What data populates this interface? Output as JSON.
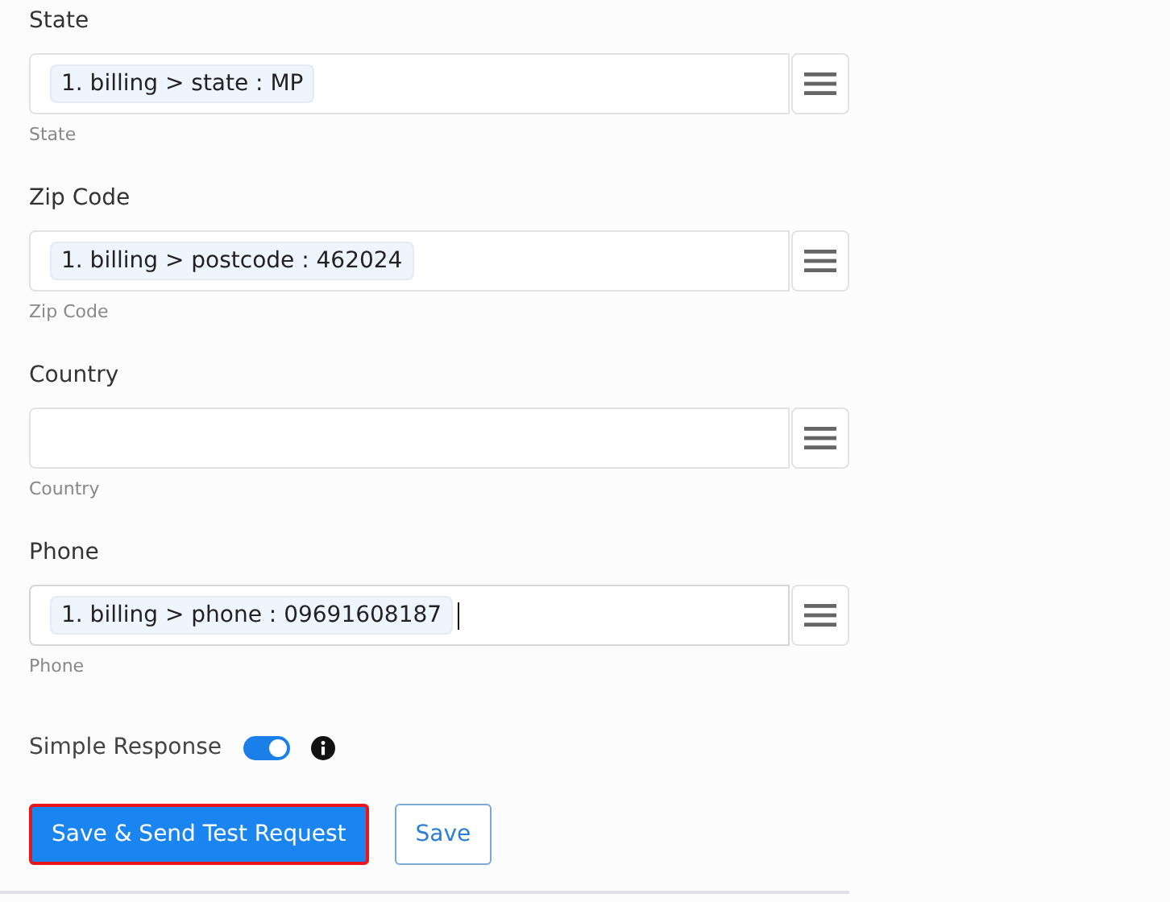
{
  "fields": [
    {
      "label": "State",
      "token": "1. billing > state : MP",
      "hint": "State",
      "focused": false
    },
    {
      "label": "Zip Code",
      "token": "1. billing > postcode : 462024",
      "hint": "Zip Code",
      "focused": false
    },
    {
      "label": "Country",
      "hint": "Country",
      "focused": false
    },
    {
      "label": "Phone",
      "token": "1. billing > phone : 09691608187",
      "hint": "Phone",
      "focused": true
    }
  ],
  "simple_response": {
    "label": "Simple Response",
    "on": true
  },
  "buttons": [
    {
      "label": "Save & Send Test Request",
      "kind": "primary",
      "highlighted": true
    },
    {
      "label": "Save",
      "kind": "outline",
      "highlighted": false
    }
  ]
}
